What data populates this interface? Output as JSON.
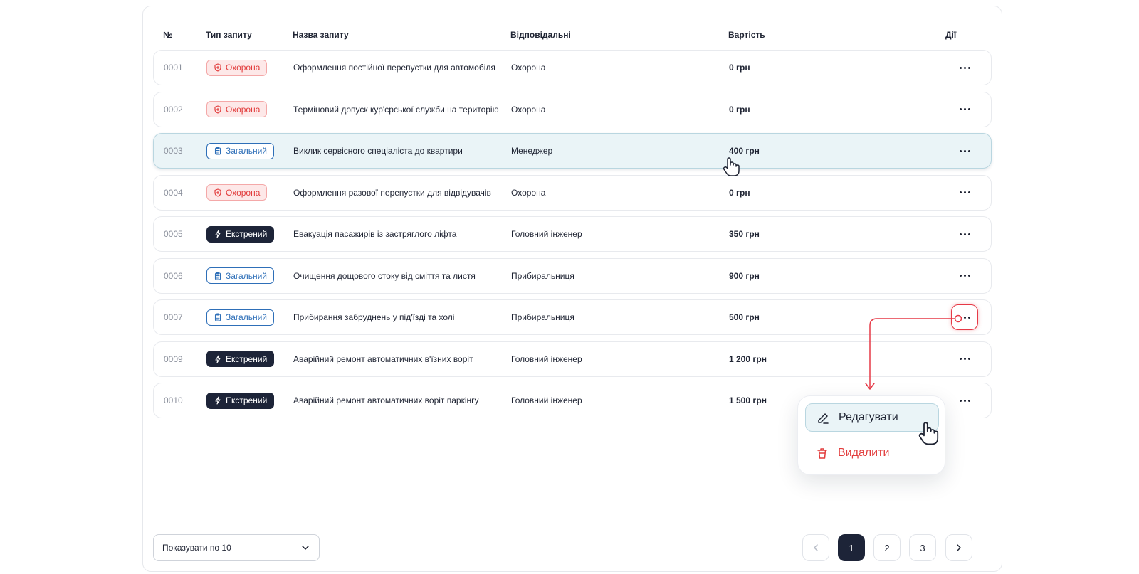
{
  "table": {
    "headers": {
      "num": "№",
      "type": "Тип запиту",
      "name": "Назва запиту",
      "responsible": "Відповідальні",
      "cost": "Вартість",
      "actions": "Дії"
    },
    "rows": [
      {
        "num": "0001",
        "type": "Охорона",
        "type_kind": "security",
        "name": "Оформлення постійної перепустки для автомобіля",
        "responsible": "Охорона",
        "cost": "0 грн"
      },
      {
        "num": "0002",
        "type": "Охорона",
        "type_kind": "security",
        "name": "Терміновий допуск кур'єрської служби на територію",
        "responsible": "Охорона",
        "cost": "0 грн"
      },
      {
        "num": "0003",
        "type": "Загальний",
        "type_kind": "general",
        "name": "Виклик сервісного спеціаліста до квартири",
        "responsible": "Менеджер",
        "cost": "400 грн"
      },
      {
        "num": "0004",
        "type": "Охорона",
        "type_kind": "security",
        "name": "Оформлення разової перепустки для відвідувачів",
        "responsible": "Охорона",
        "cost": "0 грн"
      },
      {
        "num": "0005",
        "type": "Екстрений",
        "type_kind": "emergency",
        "name": "Евакуація пасажирів із застряглого ліфта",
        "responsible": "Головний інженер",
        "cost": "350 грн"
      },
      {
        "num": "0006",
        "type": "Загальний",
        "type_kind": "general",
        "name": "Очищення дощового стоку від сміття та листя",
        "responsible": "Прибиральниця",
        "cost": "900 грн"
      },
      {
        "num": "0007",
        "type": "Загальний",
        "type_kind": "general",
        "name": "Прибирання забруднень у під'їзді та холі",
        "responsible": "Прибиральниця",
        "cost": "500 грн"
      },
      {
        "num": "0009",
        "type": "Екстрений",
        "type_kind": "emergency",
        "name": "Аварійний ремонт автоматичних в'їзних воріт",
        "responsible": "Головний інженер",
        "cost": "1 200 грн"
      },
      {
        "num": "0010",
        "type": "Екстрений",
        "type_kind": "emergency",
        "name": "Аварійний ремонт автоматичних воріт паркінгу",
        "responsible": "Головний інженер",
        "cost": "1 500 грн"
      }
    ],
    "hovered_row": "0003",
    "active_actions_row": "0007"
  },
  "context_menu": {
    "edit_label": "Редагувати",
    "delete_label": "Видалити"
  },
  "footer": {
    "page_size_label": "Показувати по 10",
    "pages": [
      "1",
      "2",
      "3"
    ],
    "current_page": "1"
  },
  "colors": {
    "security": "#e23d3d",
    "general": "#2e6fb8",
    "emergency": "#1d2438",
    "accent_red": "#e63946",
    "hover_row": "#eaf4f7"
  },
  "icons": {
    "security": "shield-icon",
    "general": "clipboard-icon",
    "emergency": "lightning-icon",
    "actions": "more-dots-icon",
    "edit": "pencil-icon",
    "delete": "trash-icon"
  }
}
